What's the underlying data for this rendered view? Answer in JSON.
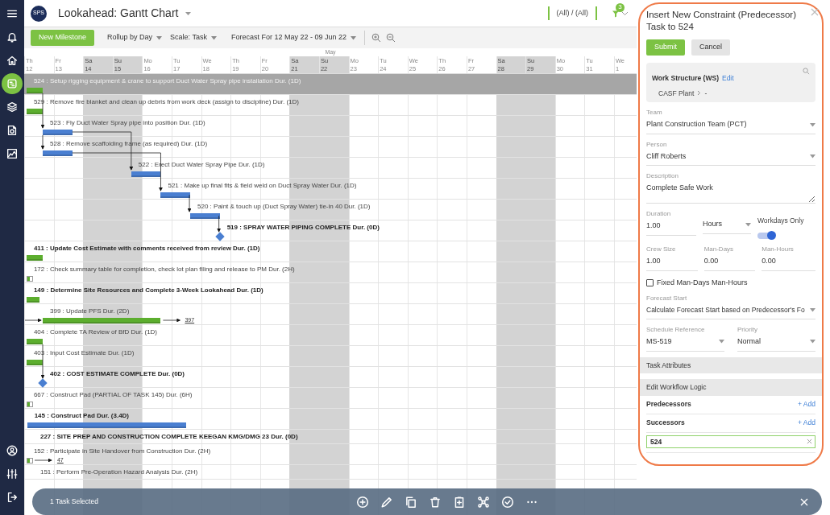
{
  "sidebar": {
    "items": [
      {
        "selected": false
      },
      {
        "selected": false
      },
      {
        "selected": false
      },
      {
        "selected": true
      },
      {
        "selected": false
      },
      {
        "selected": false
      },
      {
        "selected": false
      },
      {
        "selected": false
      },
      {
        "selected": false
      },
      {
        "selected": false
      }
    ]
  },
  "header": {
    "logo": "SPS",
    "title": "Lookahead: Gantt Chart",
    "scope": "(All) / (All)",
    "filter_count": "3"
  },
  "toolbar": {
    "new_button": "New Milestone",
    "dropdowns": [
      "Rollup by Day",
      "Scale: Task",
      "Forecast For 12 May 22 - 09 Jun 22"
    ]
  },
  "timeline": {
    "month": "May",
    "days": [
      {
        "name": "Th",
        "date": "12",
        "weekend": false
      },
      {
        "name": "Fr",
        "date": "13",
        "weekend": false
      },
      {
        "name": "Sa",
        "date": "14",
        "weekend": true
      },
      {
        "name": "Su",
        "date": "15",
        "weekend": true
      },
      {
        "name": "Mo",
        "date": "16",
        "weekend": false
      },
      {
        "name": "Tu",
        "date": "17",
        "weekend": false
      },
      {
        "name": "We",
        "date": "18",
        "weekend": false
      },
      {
        "name": "Th",
        "date": "19",
        "weekend": false
      },
      {
        "name": "Fr",
        "date": "20",
        "weekend": false
      },
      {
        "name": "Sa",
        "date": "21",
        "weekend": true
      },
      {
        "name": "Su",
        "date": "22",
        "weekend": true
      },
      {
        "name": "Mo",
        "date": "23",
        "weekend": false
      },
      {
        "name": "Tu",
        "date": "24",
        "weekend": false
      },
      {
        "name": "We",
        "date": "25",
        "weekend": false
      },
      {
        "name": "Th",
        "date": "26",
        "weekend": false
      },
      {
        "name": "Fr",
        "date": "27",
        "weekend": false
      },
      {
        "name": "Sa",
        "date": "28",
        "weekend": true
      },
      {
        "name": "Su",
        "date": "29",
        "weekend": true
      },
      {
        "name": "Mo",
        "date": "30",
        "weekend": false
      },
      {
        "name": "Tu",
        "date": "31",
        "weekend": false
      },
      {
        "name": "We",
        "date": "1",
        "weekend": false
      }
    ]
  },
  "tasks": [
    {
      "label": "524 : Setup rigging equipment & crane to support Duct Water Spray pipe installation Dur. (1D)",
      "summary": false,
      "selected": true,
      "bar": {
        "kind": "task",
        "color": "#5cae2e"
      }
    },
    {
      "label": "529 : Remove fire blanket and clean up debris from work deck (assign to discipline) Dur. (1D)",
      "summary": false,
      "selected": false,
      "bar": {
        "kind": "task",
        "color": "#5cae2e"
      }
    },
    {
      "label": "523 : Fly Duct Water Spray pipe into position Dur. (1D)",
      "summary": false,
      "selected": false,
      "bar": {
        "kind": "task",
        "color": "#4a7fd1"
      }
    },
    {
      "label": "528 : Remove scaffolding frame (as required) Dur. (1D)",
      "summary": false,
      "selected": false,
      "bar": {
        "kind": "task",
        "color": "#4a7fd1"
      }
    },
    {
      "label": "522 : Erect Duct Water Spray Pipe Dur. (1D)",
      "summary": false,
      "selected": false,
      "bar": {
        "kind": "task",
        "color": "#4a7fd1"
      }
    },
    {
      "label": "521 : Make up final fits & field weld on Duct Spray Water Dur. (1D)",
      "summary": false,
      "selected": false,
      "bar": {
        "kind": "task",
        "color": "#4a7fd1"
      }
    },
    {
      "label": "520 : Paint & touch up (Duct Spray Water) tie-in 40 Dur. (1D)",
      "summary": false,
      "selected": false,
      "bar": {
        "kind": "task",
        "color": "#4a7fd1"
      }
    },
    {
      "label": "519 : SPRAY WATER PIPING COMPLETE Dur. (0D)",
      "summary": true,
      "selected": false,
      "bar": {
        "kind": "milestone",
        "color": "#4a7fd1"
      }
    },
    {
      "label": "411 : Update Cost Estimate with comments received from review Dur. (1D)",
      "summary": true,
      "selected": false,
      "bar": {
        "kind": "task",
        "color": "#5cae2e"
      }
    },
    {
      "label": "172 : Check summary table for completion, check lot plan filing and release to PM Dur. (2H)",
      "summary": false,
      "selected": false,
      "bar": {
        "kind": "stub",
        "color": "#5cae2e"
      }
    },
    {
      "label": "149 : Determine Site Resources and Complete 3-Week Lookahead Dur. (1D)",
      "summary": true,
      "selected": false,
      "bar": {
        "kind": "task",
        "color": "#5cae2e"
      }
    },
    {
      "label": "399 : Update PFS Dur. (2D)",
      "summary": false,
      "selected": false,
      "bar": {
        "kind": "task",
        "color": "#5cae2e"
      },
      "successor": "397"
    },
    {
      "label": "404 : Complete TA Review of BfD Dur. (1D)",
      "summary": false,
      "selected": false,
      "bar": {
        "kind": "task",
        "color": "#5cae2e"
      }
    },
    {
      "label": "403 : Input Cost Estimate Dur. (1D)",
      "summary": false,
      "selected": false,
      "bar": {
        "kind": "task",
        "color": "#5cae2e"
      }
    },
    {
      "label": "402 : COST ESTIMATE COMPLETE Dur. (0D)",
      "summary": true,
      "selected": false,
      "bar": {
        "kind": "milestone",
        "color": "#4a7fd1"
      }
    },
    {
      "label": "667 : Construct Pad (PARTIAL OF TASK 145) Dur. (6H)",
      "summary": false,
      "selected": false,
      "bar": {
        "kind": "stub",
        "color": "#5cae2e"
      }
    },
    {
      "label": "145 : Construct Pad Dur. (3.4D)",
      "summary": true,
      "selected": false,
      "bar": {
        "kind": "task",
        "color": "#4a7fd1"
      }
    },
    {
      "label": "227 : SITE PREP AND CONSTRUCTION COMPLETE KEEGAN KMG/DMG 23 Dur. (0D)",
      "summary": true,
      "selected": false
    },
    {
      "label": "152 : Participate in Site Handover from Construction Dur. (2H)",
      "summary": false,
      "selected": false,
      "bar": {
        "kind": "stub",
        "color": "#5cae2e"
      },
      "successor": "47"
    },
    {
      "label": "151 : Perform Pre-Operation Hazard Analysis Dur. (2H)",
      "summary": false,
      "selected": false
    }
  ],
  "panel": {
    "title": "Insert New Constraint (Predecessor) Task to 524",
    "buttons": [
      {
        "label": "Submit",
        "kind": "primary"
      },
      {
        "label": "Cancel",
        "kind": "secondary"
      }
    ],
    "work_structure": {
      "label": "Work Structure (WS)",
      "edit": "Edit",
      "path": [
        "CASF Plant",
        "-"
      ]
    },
    "team": {
      "label": "Team",
      "value": "Plant Construction Team (PCT)"
    },
    "person": {
      "label": "Person",
      "value": "Cliff Roberts"
    },
    "description": {
      "label": "Description",
      "value": "Complete Safe Work"
    },
    "duration": {
      "label": "Duration",
      "value": "1.00",
      "unit": "Hours"
    },
    "workdays_only": {
      "label": "Workdays Only",
      "on": true
    },
    "quantities": [
      {
        "label": "Crew Size",
        "value": "1.00"
      },
      {
        "label": "Man-Days",
        "value": "0.00"
      },
      {
        "label": "Man-Hours",
        "value": "0.00"
      }
    ],
    "fixed": {
      "label": "Fixed Man-Days Man-Hours",
      "checked": false
    },
    "forecast_start": {
      "label": "Forecast Start",
      "value": "Calculate Forecast Start based on Predecessor's Fo"
    },
    "schedule_reference": {
      "label": "Schedule Reference",
      "value": "MS-519"
    },
    "priority": {
      "label": "Priority",
      "value": "Normal"
    },
    "sections": [
      "Task Attributes",
      "Edit Workflow Logic"
    ],
    "logic": [
      {
        "label": "Predecessors",
        "add": "+ Add"
      },
      {
        "label": "Successors",
        "add": "+ Add"
      }
    ],
    "successor_input": {
      "value": "524"
    }
  },
  "selection_bar": {
    "text": "1 Task Selected"
  }
}
